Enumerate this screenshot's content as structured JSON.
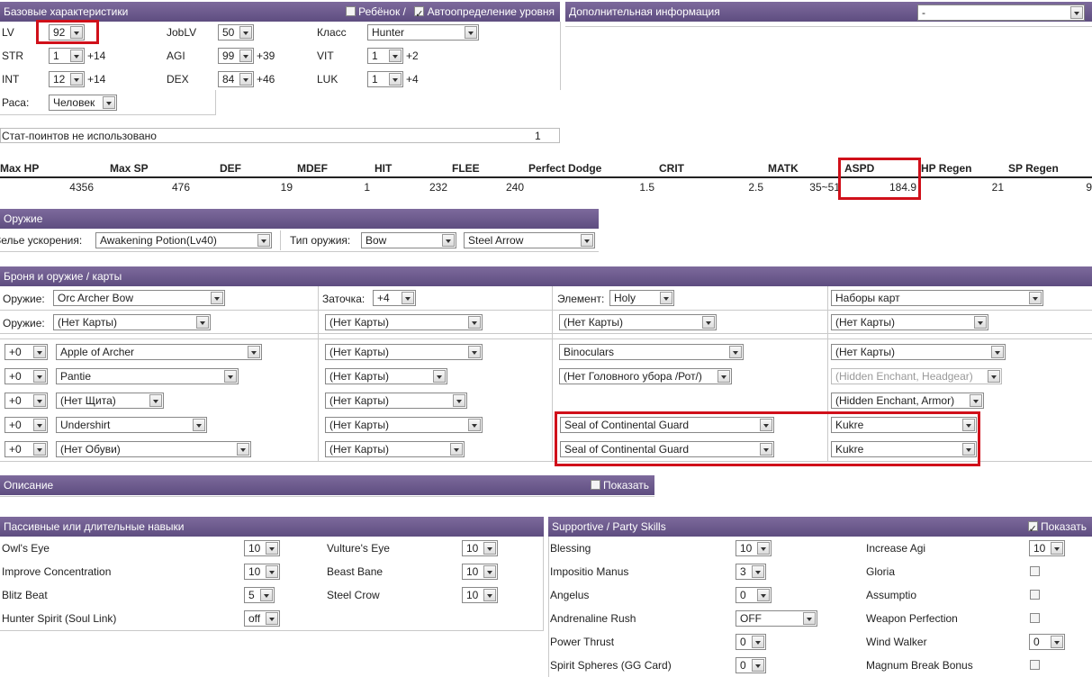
{
  "base": {
    "title": "Базовые характеристики",
    "child_label": "Ребёнок /",
    "child_checked": false,
    "auto_label": "Автоопределение уровня",
    "auto_checked": true,
    "lv_label": "LV",
    "lv": "92",
    "joblv_label": "JobLV",
    "joblv": "50",
    "class_label": "Класс",
    "class": "Hunter",
    "str_label": "STR",
    "str": "1",
    "str_bonus": "+14",
    "agi_label": "AGI",
    "agi": "99",
    "agi_bonus": "+39",
    "vit_label": "VIT",
    "vit": "1",
    "vit_bonus": "+2",
    "int_label": "INT",
    "int": "12",
    "int_bonus": "+14",
    "dex_label": "DEX",
    "dex": "84",
    "dex_bonus": "+46",
    "luk_label": "LUK",
    "luk": "1",
    "luk_bonus": "+4",
    "race_label": "Раса:",
    "race": "Человек",
    "unused_label": "Стат-поинтов не использовано",
    "unused": "1"
  },
  "extra": {
    "title": "Дополнительная информация",
    "value": "-"
  },
  "stats": [
    {
      "name": "Max HP",
      "value": "4356"
    },
    {
      "name": "Max SP",
      "value": "476"
    },
    {
      "name": "DEF",
      "value": "19"
    },
    {
      "name": "MDEF",
      "value": "1"
    },
    {
      "name": "HIT",
      "value": "232"
    },
    {
      "name": "FLEE",
      "value": "240"
    },
    {
      "name": "Perfect Dodge",
      "value": "1.5"
    },
    {
      "name": "CRIT",
      "value": "2.5"
    },
    {
      "name": "MATK",
      "value": "35~51"
    },
    {
      "name": "ASPD",
      "value": "184.9"
    },
    {
      "name": "HP Regen",
      "value": "21"
    },
    {
      "name": "SP Regen",
      "value": "9"
    }
  ],
  "weapon": {
    "title": "Оружие",
    "potion_label": "Зелье ускорения:",
    "potion": "Awakening Potion(Lv40)",
    "type_label": "Тип оружия:",
    "type": "Bow",
    "ammo": "Steel Arrow"
  },
  "armor": {
    "title": "Броня и оружие / карты",
    "weapon_label": "Оружие:",
    "weapon": "Orc Archer Bow",
    "refine_label": "Заточка:",
    "refine": "+4",
    "element_label": "Элемент:",
    "element": "Holy",
    "card_sets": "Наборы карт",
    "weapon2_label": "Оружие:",
    "wcard1": "(Нет Карты)",
    "wcard2": "(Нет Карты)",
    "wcard3": "(Нет Карты)",
    "wcard4": "(Нет Карты)",
    "rows": [
      {
        "refine": "+0",
        "item": "Apple of Archer",
        "card": "(Нет Карты)",
        "mid": "Binoculars",
        "right": "(Нет Карты)"
      },
      {
        "refine": "+0",
        "item": "Pantie",
        "card": "(Нет Карты)",
        "mid": "(Нет Головного убора /Рот/)",
        "right": "(Hidden Enchant, Headgear)"
      },
      {
        "refine": "+0",
        "item": "(Нет Щита)",
        "card": "(Нет Карты)",
        "mid": "",
        "right": "(Hidden Enchant, Armor)"
      },
      {
        "refine": "+0",
        "item": "Undershirt",
        "card": "(Нет Карты)",
        "mid": "Seal of Continental Guard",
        "right": "Kukre"
      },
      {
        "refine": "+0",
        "item": "(Нет Обуви)",
        "card": "(Нет Карты)",
        "mid": "Seal of Continental Guard",
        "right": "Kukre"
      }
    ]
  },
  "desc": {
    "title": "Описание",
    "show_label": "Показать"
  },
  "passive": {
    "title": "Пассивные или длительные навыки",
    "skills": [
      {
        "name": "Owl's Eye",
        "value": "10"
      },
      {
        "name": "Vulture's Eye",
        "value": "10"
      },
      {
        "name": "Improve Concentration",
        "value": "10"
      },
      {
        "name": "Beast Bane",
        "value": "10"
      },
      {
        "name": "Blitz Beat",
        "value": "5"
      },
      {
        "name": "Steel Crow",
        "value": "10"
      },
      {
        "name": "Hunter Spirit (Soul Link)",
        "value": "off"
      }
    ]
  },
  "support": {
    "title": "Supportive / Party Skills",
    "show_label": "Показать",
    "left": [
      {
        "name": "Blessing",
        "value": "10"
      },
      {
        "name": "Impositio Manus",
        "value": "3"
      },
      {
        "name": "Angelus",
        "value": "0"
      },
      {
        "name": "Andrenaline Rush",
        "value": "OFF"
      },
      {
        "name": "Power Thrust",
        "value": "0"
      },
      {
        "name": "Spirit Spheres (GG Card)",
        "value": "0"
      }
    ],
    "right": [
      {
        "name": "Increase Agi",
        "value": "10"
      },
      {
        "name": "Gloria"
      },
      {
        "name": "Assumptio"
      },
      {
        "name": "Weapon Perfection"
      },
      {
        "name": "Wind Walker",
        "value": "0"
      },
      {
        "name": "Magnum Break Bonus"
      }
    ]
  }
}
